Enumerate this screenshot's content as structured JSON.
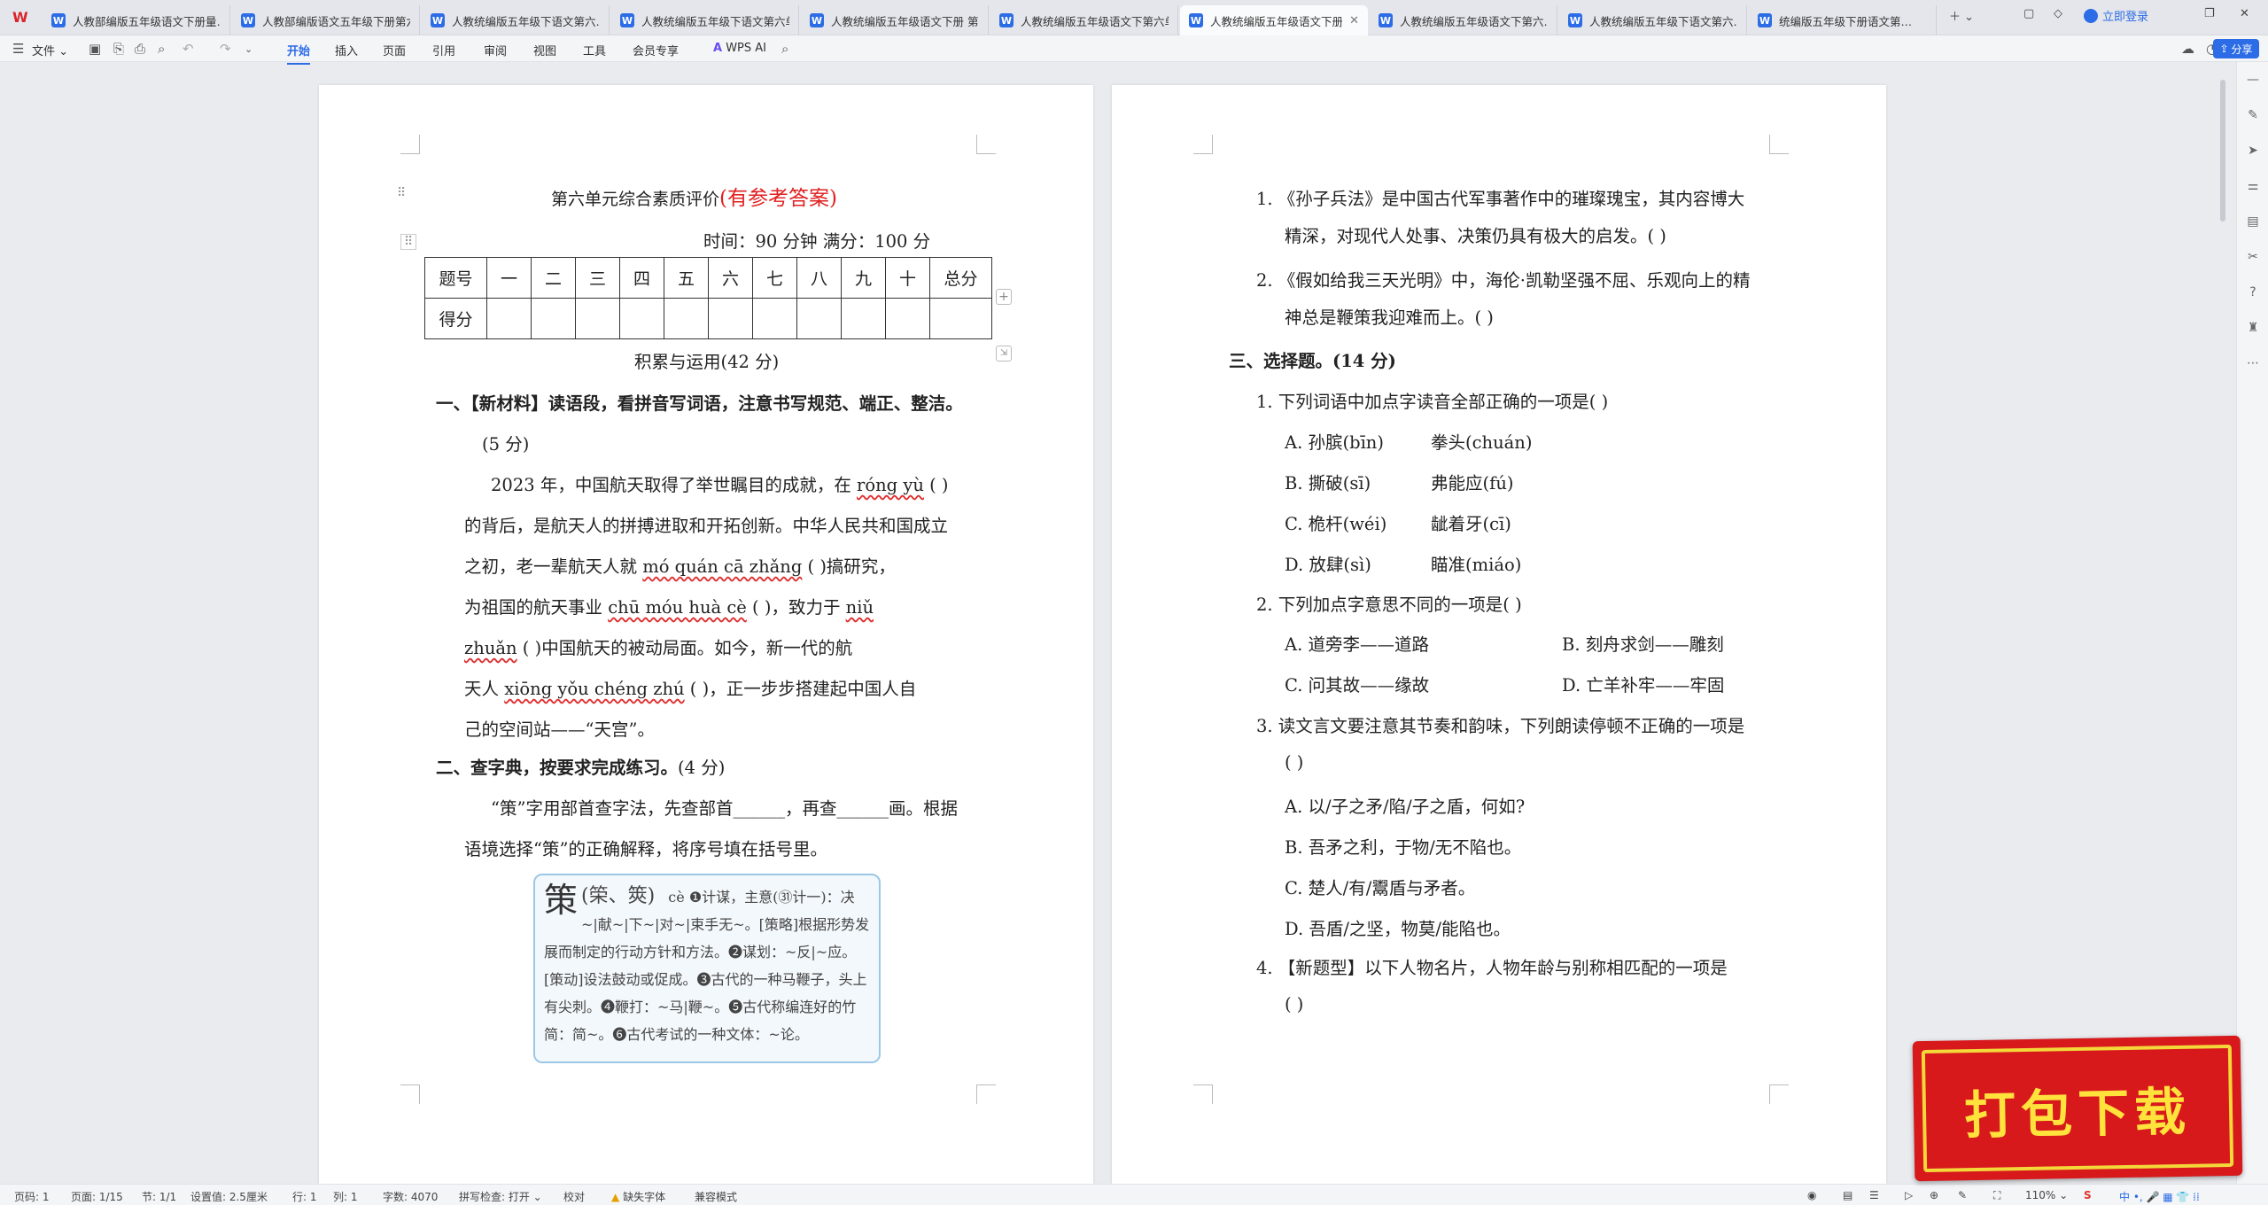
{
  "tabbar": {
    "tabs": [
      {
        "label": "人教部编版五年级语文下册量…",
        "active": false
      },
      {
        "label": "人教部编版语文五年级下册第六…",
        "active": false
      },
      {
        "label": "人教统编版五年级下语文第六…",
        "active": false
      },
      {
        "label": "人教统编版五年级下语文第六单…",
        "active": false
      },
      {
        "label": "人教统编版五年级语文下册 第6…",
        "active": false
      },
      {
        "label": "人教统编版五年级语文下第六单…",
        "active": false
      },
      {
        "label": "人教统编版五年级语文下册第六…",
        "active": true
      },
      {
        "label": "人教统编版五年级语文下第六…",
        "active": false
      },
      {
        "label": "人教统编版五年级下语文第六…",
        "active": false
      },
      {
        "label": "统编版五年级下册语文第…",
        "active": false
      }
    ],
    "login": "立即登录"
  },
  "menubar": {
    "file": "文件",
    "items": [
      "开始",
      "插入",
      "页面",
      "引用",
      "审阅",
      "视图",
      "工具",
      "会员专享"
    ],
    "active": "开始",
    "wps_ai": "WPS AI",
    "share": "分享"
  },
  "left_page": {
    "title": "第六单元综合素质评价",
    "title_red": "(有参考答案)",
    "time_info": "时间：90 分钟    满分：100 分",
    "table_row1": [
      "题号",
      "一",
      "二",
      "三",
      "四",
      "五",
      "六",
      "七",
      "八",
      "九",
      "十",
      "总分"
    ],
    "table_row2_label": "得分",
    "section_heading": "积累与运用(42 分)",
    "q1_heading": "一、【新材料】读语段，看拼音写词语，注意书写规范、端正、整洁。",
    "q1_score": "(5 分)",
    "q1_lines": [
      [
        "2023 年，中国航天取得了举世瞩目的成就，在 ",
        "róng yù",
        " (          )"
      ],
      [
        "的背后，是航天人的拼搏进取和开拓创新。中华人民共和国成立"
      ],
      [
        "之初，老一辈航天人就 ",
        "mó quán cā zhǎng",
        " (               )搞研究，"
      ],
      [
        "为祖国的航天事业 ",
        "chū móu huà cè",
        " (               )，致力于 ",
        "niǔ"
      ],
      [
        "",
        "zhuǎn",
        " (               )中国航天的被动局面。如今，新一代的航"
      ],
      [
        "天人 ",
        "xiōng yǒu chéng zhú",
        " (             )，正一步步搭建起中国人自"
      ],
      [
        "己的空间站——“天宫”。"
      ]
    ],
    "q2_heading": "二、查字典，按要求完成练习。",
    "q2_score": "(4 分)",
    "q2_lines": [
      "“策”字用部首查字法，先查部首______，再查______画。根据",
      "语境选择“策”的正确解释，将序号填在括号里。"
    ],
    "dict": {
      "char": "策",
      "variants": "(筞、筴)",
      "pinyin": "cè",
      "text": "❶计谋，主意(㉛计一)：决~|献~|下~|对~|束手无~。[策略]根据形势发展而制定的行动方针和方法。❷谋划：~反|~应。[策动]设法鼓动或促成。❸古代的一种马鞭子，头上有尖刺。❹鞭打：~马|鞭~。❺古代称编连好的竹简：简~。❻古代考试的一种文体：~论。"
    }
  },
  "right_page": {
    "items": [
      "1. 《孙子兵法》是中国古代军事著作中的璀璨瑰宝，其内容博大",
      "精深，对现代人处事、决策仍具有极大的启发。(        )",
      "2. 《假如给我三天光明》中，海伦·凯勒坚强不屈、乐观向上的精",
      "神总是鞭策我迎难而上。(        )"
    ],
    "q3_heading": "三、选择题。(14 分)",
    "q3_1": "1. 下列词语中加点字读音全部正确的一项是(        )",
    "q3_1_options": [
      [
        "A. 孙膑(bīn)",
        "拳头(chuán)"
      ],
      [
        "B. 撕破(sī)",
        "弗能应(fú)"
      ],
      [
        "C. 桅杆(wéi)",
        "龇着牙(cī)"
      ],
      [
        "D. 放肆(sì)",
        "瞄准(miáo)"
      ]
    ],
    "q3_2": "2. 下列加点字意思不同的一项是(        )",
    "q3_2_options": [
      [
        "A. 道旁李——道路",
        "B. 刻舟求剑——雕刻"
      ],
      [
        "C. 问其故——缘故",
        "D. 亡羊补牢——牢固"
      ]
    ],
    "q3_3": "3. 读文言文要注意其节奏和韵味，下列朗读停顿不正确的一项是",
    "q3_3_blank": "(        )",
    "q3_3_options": [
      "A. 以/子之矛/陷/子之盾，何如?",
      "B. 吾矛之利，于物/无不陷也。",
      "C. 楚人/有/鬻盾与矛者。",
      "D. 吾盾/之坚，物莫/能陷也。"
    ],
    "q3_4": "4. 【新题型】以下人物名片，人物年龄与别称相匹配的一项是",
    "q3_4_blank": "(        )"
  },
  "statusbar": {
    "page_code": "页码: 1",
    "page": "页面: 1/15",
    "section": "节: 1/1",
    "setting": "设置值: 2.5厘米",
    "row": "行: 1",
    "col": "列: 1",
    "words": "字数: 4070",
    "spell": "拼写检查: 打开",
    "proof": "校对",
    "font_missing": "缺失字体",
    "compat": "兼容模式",
    "zoom": "110%"
  },
  "promo": {
    "text": "打包下载"
  }
}
